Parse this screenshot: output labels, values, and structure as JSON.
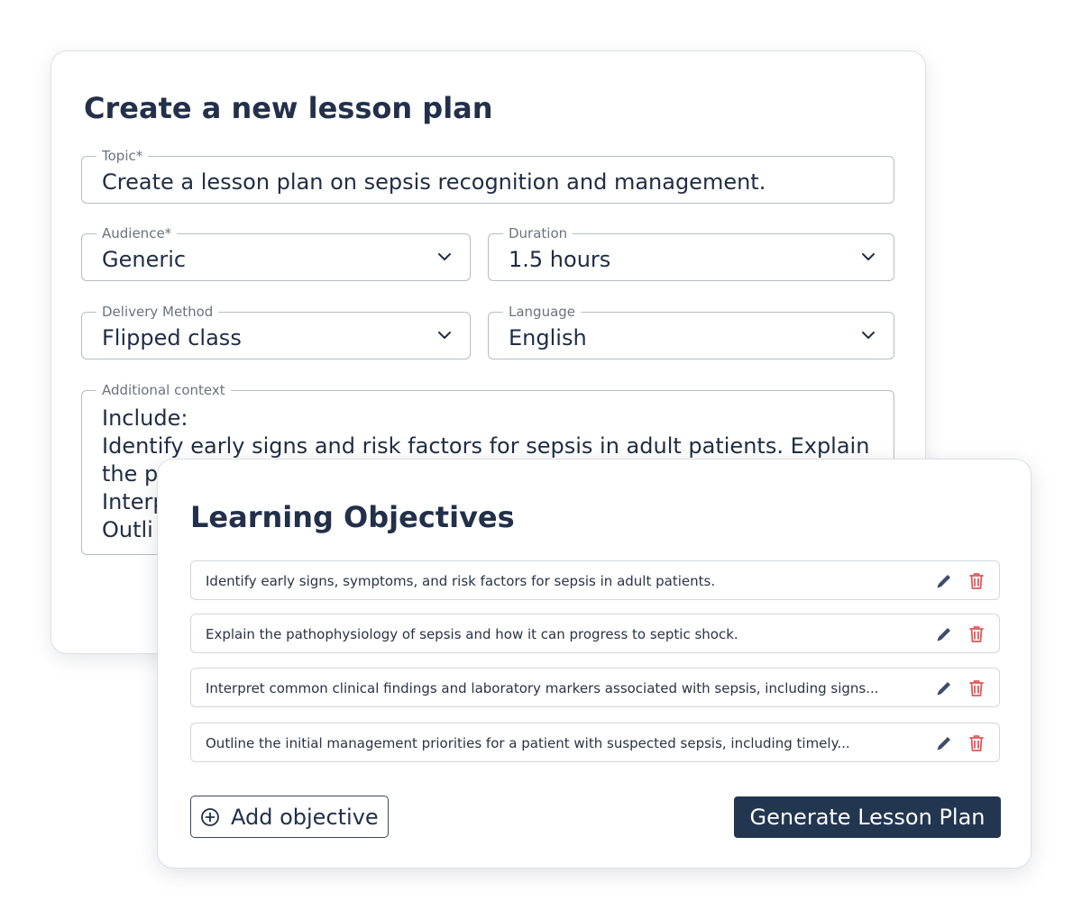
{
  "lesson_form": {
    "title": "Create a new lesson plan",
    "topic": {
      "label": "Topic*",
      "value": "Create a lesson plan on sepsis recognition and management."
    },
    "audience": {
      "label": "Audience*",
      "value": "Generic",
      "icon": "chevron-down-icon"
    },
    "duration": {
      "label": "Duration",
      "value": "1.5 hours",
      "icon": "chevron-down-icon"
    },
    "delivery": {
      "label": "Delivery Method",
      "value": "Flipped class",
      "icon": "chevron-down-icon"
    },
    "language": {
      "label": "Language",
      "value": "English",
      "icon": "chevron-down-icon"
    },
    "context": {
      "label": "Additional context",
      "value": "Include:\nIdentify early signs and risk factors for sepsis in adult patients. Explain\nthe p\nInterp\nOutli"
    }
  },
  "objectives": {
    "title": "Learning Objectives",
    "items": [
      {
        "text": "Identify early signs, symptoms, and risk factors for sepsis in adult patients."
      },
      {
        "text": "Explain the pathophysiology of sepsis and how it can progress to septic shock."
      },
      {
        "text": "Interpret common clinical findings and laboratory markers associated with sepsis, including signs..."
      },
      {
        "text": "Outline the initial management priorities for a patient with suspected sepsis, including timely..."
      }
    ],
    "edit_icon": "pencil-icon",
    "delete_icon": "trash-icon",
    "add_label": "Add objective",
    "add_icon": "plus-circle-icon",
    "generate_label": "Generate Lesson Plan"
  },
  "colors": {
    "primary": "#233650",
    "edit_icon": "#3d4d6b",
    "delete_icon": "#e0585a",
    "border": "#b7bcc4"
  }
}
